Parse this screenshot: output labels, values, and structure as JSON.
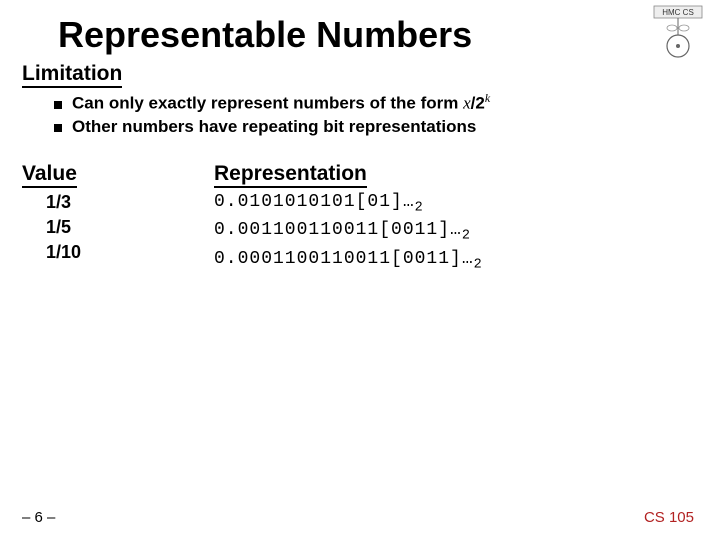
{
  "title": "Representable Numbers",
  "logo_text": "HMC CS",
  "sections": {
    "limitation": "Limitation",
    "value": "Value",
    "representation": "Representation"
  },
  "bullets": {
    "b1_prefix": "Can only exactly represent numbers of the form ",
    "b1_var": "x",
    "b1_mid": "/2",
    "b1_sup": "k",
    "b2": "Other numbers have repeating bit representations"
  },
  "table": {
    "values": [
      "1/3",
      "1/5",
      "1/10"
    ],
    "reprs": [
      {
        "digits": "0.0101010101[01]…",
        "sub": "2"
      },
      {
        "digits": "0.001100110011[0011]…",
        "sub": "2"
      },
      {
        "digits": "0.0001100110011[0011]…",
        "sub": "2"
      }
    ]
  },
  "footer": {
    "page": "– 6 –",
    "course": "CS 105"
  }
}
